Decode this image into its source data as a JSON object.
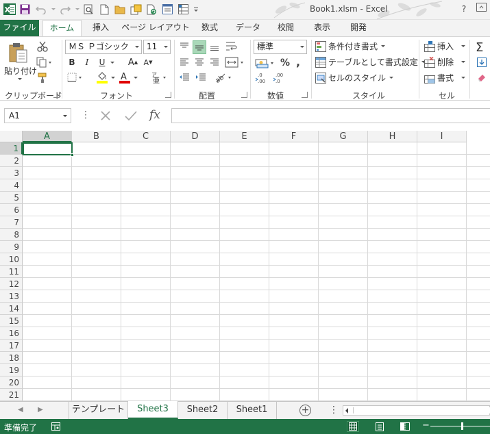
{
  "window": {
    "title": "Book1.xlsm - Excel",
    "help": "?"
  },
  "ribbon_tabs": [
    {
      "label": "ファイル",
      "id": "file"
    },
    {
      "label": "ホーム",
      "id": "home",
      "active": true
    },
    {
      "label": "挿入",
      "id": "insert"
    },
    {
      "label": "ページ レイアウト",
      "id": "page-layout"
    },
    {
      "label": "数式",
      "id": "formulas"
    },
    {
      "label": "データ",
      "id": "data"
    },
    {
      "label": "校閲",
      "id": "review"
    },
    {
      "label": "表示",
      "id": "view"
    },
    {
      "label": "開発",
      "id": "developer"
    }
  ],
  "clipboard": {
    "paste_label": "貼り付け",
    "group_label": "クリップボード"
  },
  "font": {
    "name": "ＭＳ Ｐゴシック",
    "size": "11",
    "bold": "B",
    "italic": "I",
    "underline": "U",
    "grow": "A",
    "shrink": "A",
    "group_label": "フォント",
    "highlight_color": "#ffff00",
    "font_color": "#e00000"
  },
  "alignment": {
    "group_label": "配置"
  },
  "number": {
    "format": "標準",
    "percent": "%",
    "comma": ",",
    "group_label": "数値"
  },
  "styles": {
    "conditional": "条件付き書式",
    "table": "テーブルとして書式設定",
    "cell_styles": "セルのスタイル",
    "group_label": "スタイル"
  },
  "cells_group": {
    "insert": "挿入",
    "delete": "削除",
    "format": "書式",
    "group_label": "セル"
  },
  "formula_bar": {
    "name_box": "A1",
    "fx": "fx",
    "value": ""
  },
  "grid": {
    "columns": [
      "A",
      "B",
      "C",
      "D",
      "E",
      "F",
      "G",
      "H",
      "I"
    ],
    "rows": [
      "1",
      "2",
      "3",
      "4",
      "5",
      "6",
      "7",
      "8",
      "9",
      "10",
      "11",
      "12",
      "13",
      "14",
      "15",
      "16",
      "17",
      "18",
      "19",
      "20",
      "21"
    ],
    "selected_cell": "A1"
  },
  "sheets": [
    {
      "label": "テンプレート"
    },
    {
      "label": "Sheet3",
      "active": true
    },
    {
      "label": "Sheet2"
    },
    {
      "label": "Sheet1"
    }
  ],
  "status": {
    "text": "準備完了"
  },
  "colors": {
    "accent": "#217346",
    "status_bar": "#217346"
  }
}
